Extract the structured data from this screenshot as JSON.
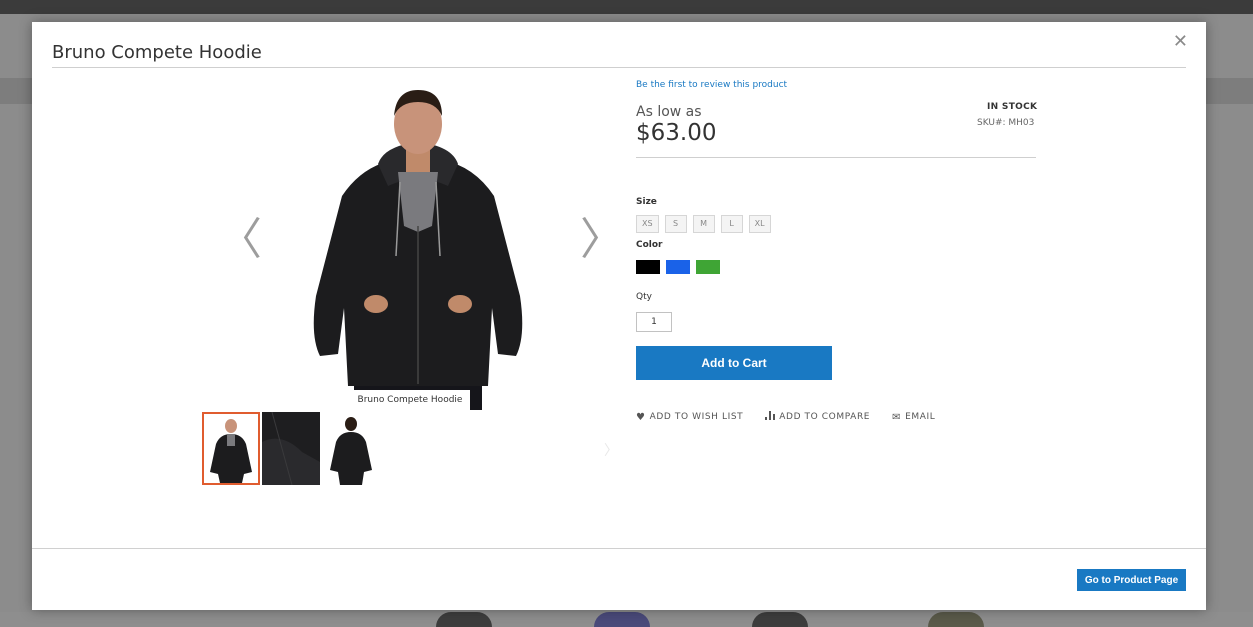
{
  "modal": {
    "title": "Bruno Compete Hoodie",
    "close_icon": "close-icon",
    "go_button": "Go to Product Page"
  },
  "gallery": {
    "caption": "Bruno Compete Hoodie",
    "prev_icon": "chevron-left-icon",
    "next_icon": "chevron-right-icon",
    "thumbnails": [
      {
        "view": "front",
        "active": true
      },
      {
        "view": "detail",
        "active": false
      },
      {
        "view": "back",
        "active": false
      }
    ]
  },
  "product": {
    "review_link": "Be the first to review this product",
    "price_prefix": "As low as",
    "price": "$63.00",
    "stock": "IN STOCK",
    "sku": "SKU#:  MH03",
    "size_label": "Size",
    "sizes": [
      "XS",
      "S",
      "M",
      "L",
      "XL"
    ],
    "color_label": "Color",
    "colors": [
      "#000000",
      "#1a62e8",
      "#3fa535"
    ],
    "qty_label": "Qty",
    "qty_value": "1",
    "add_to_cart": "Add to Cart"
  },
  "actions": {
    "wishlist": "ADD TO WISH LIST",
    "compare": "ADD TO COMPARE",
    "email": "EMAIL"
  }
}
